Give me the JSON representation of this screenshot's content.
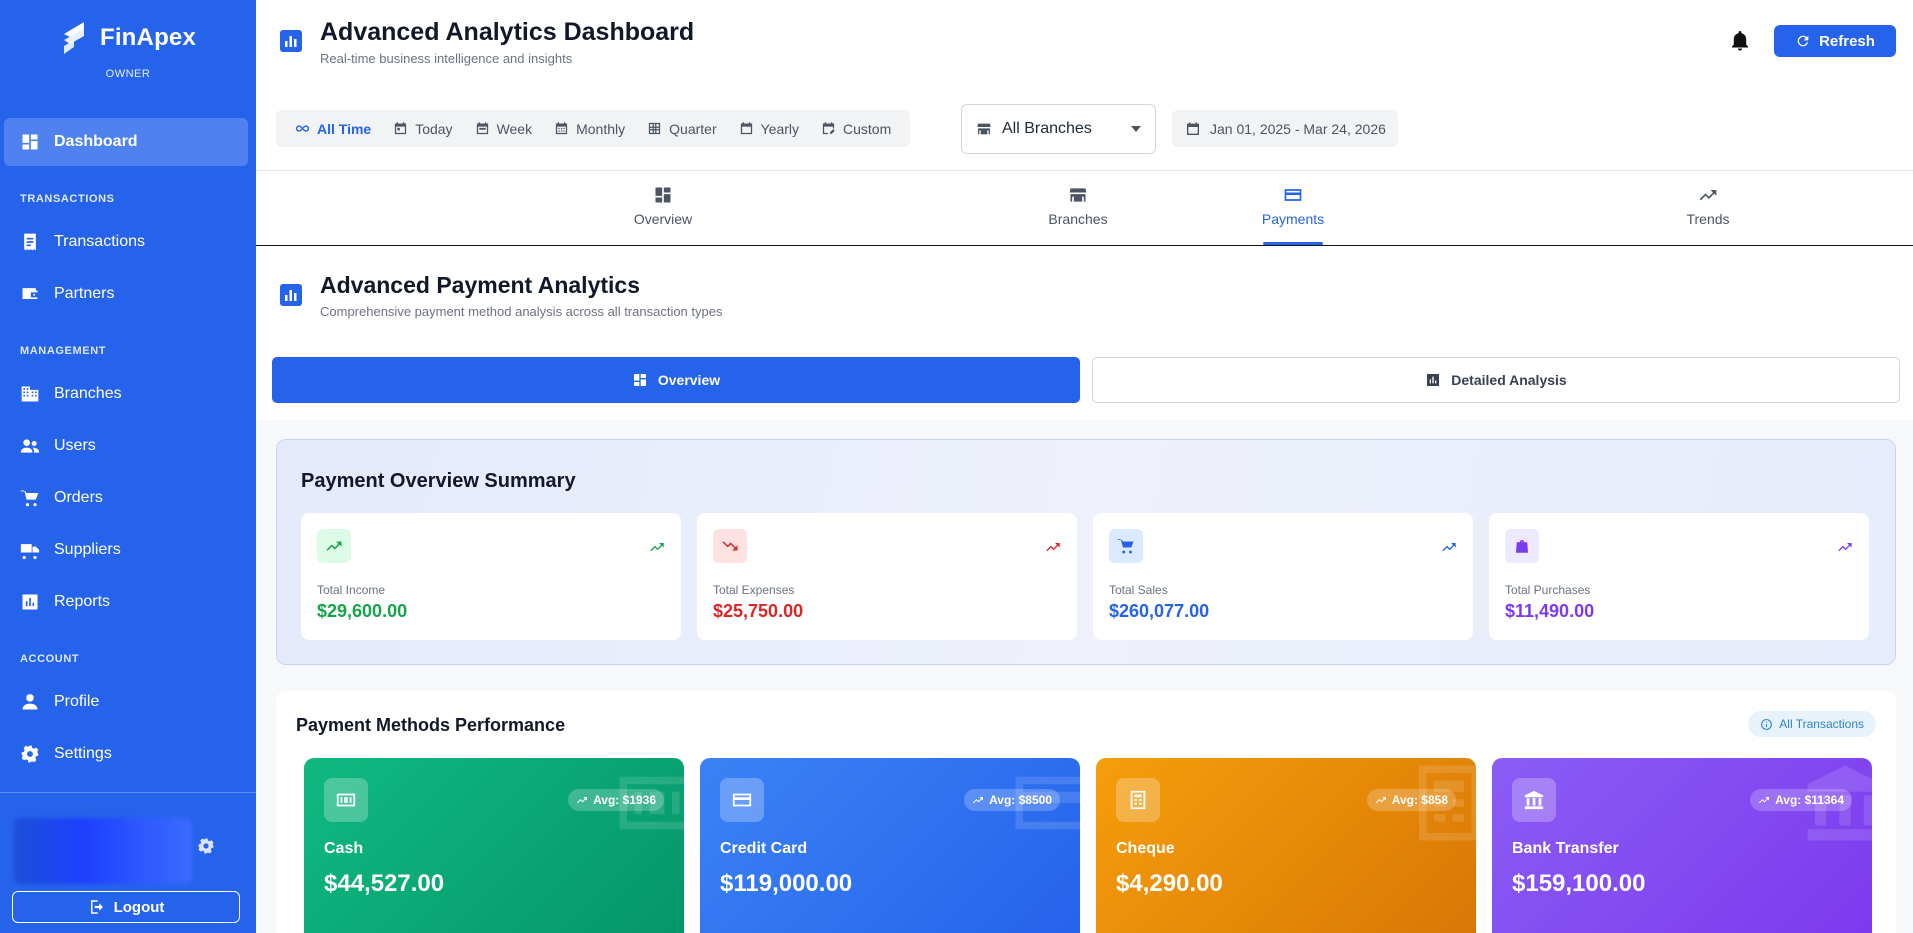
{
  "brand": {
    "name": "FinApex",
    "role": "OWNER"
  },
  "sidebar": {
    "sections": {
      "transactions": "TRANSACTIONS",
      "management": "MANAGEMENT",
      "account": "ACCOUNT"
    },
    "items": [
      {
        "label": "Dashboard",
        "icon": "dashboard-icon",
        "active": true
      },
      {
        "label": "Transactions",
        "icon": "receipt-icon"
      },
      {
        "label": "Partners",
        "icon": "wallet-icon"
      },
      {
        "label": "Branches",
        "icon": "building-icon"
      },
      {
        "label": "Users",
        "icon": "users-icon"
      },
      {
        "label": "Orders",
        "icon": "cart-icon"
      },
      {
        "label": "Suppliers",
        "icon": "truck-icon"
      },
      {
        "label": "Reports",
        "icon": "report-icon"
      },
      {
        "label": "Profile",
        "icon": "person-icon"
      },
      {
        "label": "Settings",
        "icon": "gear-icon"
      }
    ],
    "logout": "Logout"
  },
  "header": {
    "title": "Advanced Analytics Dashboard",
    "subtitle": "Real-time business intelligence and insights",
    "refresh": "Refresh"
  },
  "filters": {
    "periods": [
      "All Time",
      "Today",
      "Week",
      "Monthly",
      "Quarter",
      "Yearly",
      "Custom"
    ],
    "active_period": "All Time",
    "branch": "All Branches",
    "date_range": "Jan 01, 2025 - Mar 24, 2026"
  },
  "tabs": [
    {
      "label": "Overview"
    },
    {
      "label": "Branches"
    },
    {
      "label": "Payments",
      "active": true
    },
    {
      "label": "Trends"
    }
  ],
  "section": {
    "title": "Advanced Payment Analytics",
    "subtitle": "Comprehensive payment method analysis across all transaction types",
    "subtabs": [
      "Overview",
      "Detailed Analysis"
    ]
  },
  "summary": {
    "title": "Payment Overview Summary",
    "cards": [
      {
        "label": "Total Income",
        "value": "$29,600.00",
        "color": "#16a34a",
        "icon": "trending-up-icon"
      },
      {
        "label": "Total Expenses",
        "value": "$25,750.00",
        "color": "#dc2626",
        "icon": "trending-down-icon"
      },
      {
        "label": "Total Sales",
        "value": "$260,077.00",
        "color": "#2563eb",
        "icon": "cart-icon"
      },
      {
        "label": "Total Purchases",
        "value": "$11,490.00",
        "color": "#7c3aed",
        "icon": "shopping-bag-icon"
      }
    ]
  },
  "methods": {
    "title": "Payment Methods Performance",
    "badge": "All Transactions",
    "cards": [
      {
        "name": "Cash",
        "value": "$44,527.00",
        "avg": "Avg: $1936",
        "icon": "cash-icon",
        "colors": [
          "#10b981",
          "#059669"
        ]
      },
      {
        "name": "Credit Card",
        "value": "$119,000.00",
        "avg": "Avg: $8500",
        "icon": "credit-card-icon",
        "colors": [
          "#3b82f6",
          "#2563eb"
        ]
      },
      {
        "name": "Cheque",
        "value": "$4,290.00",
        "avg": "Avg: $858",
        "icon": "cheque-icon",
        "colors": [
          "#f59e0b",
          "#d97706"
        ]
      },
      {
        "name": "Bank Transfer",
        "value": "$159,100.00",
        "avg": "Avg: $11364",
        "icon": "bank-icon",
        "colors": [
          "#8b5cf6",
          "#7c3aed"
        ]
      }
    ]
  }
}
